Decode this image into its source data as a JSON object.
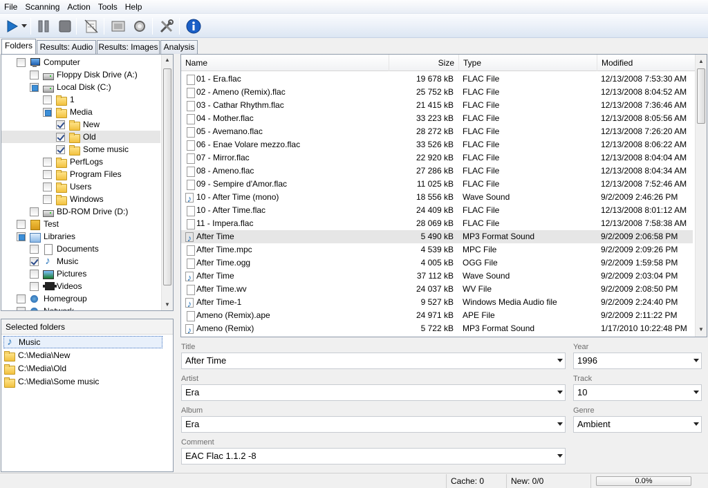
{
  "menu": [
    "File",
    "Scanning",
    "Action",
    "Tools",
    "Help"
  ],
  "toolbar": {
    "buttons": [
      "play-icon",
      "dropdown-arrow-icon",
      "pause-icon",
      "stop-icon",
      "clean-icon",
      "image-view-icon",
      "gear-scan-icon",
      "tools-icon",
      "info-icon"
    ]
  },
  "tabs": [
    "Folders",
    "Results: Audio",
    "Results: Images",
    "Analysis"
  ],
  "tree": [
    {
      "label": "Computer",
      "state": "none",
      "icon": "computer"
    },
    {
      "label": "Floppy Disk Drive (A:)",
      "state": "none",
      "icon": "drive"
    },
    {
      "label": "Local Disk (C:)",
      "state": "partial",
      "icon": "drive"
    },
    {
      "label": "1",
      "state": "none",
      "icon": "folder"
    },
    {
      "label": "Media",
      "state": "partial",
      "icon": "folder"
    },
    {
      "label": "New",
      "state": "checked",
      "icon": "folder"
    },
    {
      "label": "Old",
      "state": "checked",
      "icon": "folder"
    },
    {
      "label": "Some music",
      "state": "checked",
      "icon": "folder"
    },
    {
      "label": "PerfLogs",
      "state": "none",
      "icon": "folder"
    },
    {
      "label": "Program Files",
      "state": "none",
      "icon": "folder"
    },
    {
      "label": "Users",
      "state": "none",
      "icon": "folder"
    },
    {
      "label": "Windows",
      "state": "none",
      "icon": "folder"
    },
    {
      "label": "BD-ROM Drive (D:)",
      "state": "none",
      "icon": "drive"
    },
    {
      "label": "Test",
      "state": "none",
      "icon": "user"
    },
    {
      "label": "Libraries",
      "state": "partial",
      "icon": "library"
    },
    {
      "label": "Documents",
      "state": "none",
      "icon": "doc"
    },
    {
      "label": "Music",
      "state": "checked",
      "icon": "music"
    },
    {
      "label": "Pictures",
      "state": "none",
      "icon": "pictures"
    },
    {
      "label": "Videos",
      "state": "none",
      "icon": "videos"
    },
    {
      "label": "Homegroup",
      "state": "none",
      "icon": "homegroup"
    },
    {
      "label": "Network",
      "state": "none",
      "icon": "homegroup"
    }
  ],
  "selected_folders": {
    "header": "Selected folders",
    "items": [
      "Music",
      "C:\\Media\\New",
      "C:\\Media\\Old",
      "C:\\Media\\Some music"
    ]
  },
  "file_list": {
    "columns": [
      "Name",
      "Size",
      "Type",
      "Modified"
    ],
    "rows": [
      {
        "name": "01 - Era.flac",
        "size": "19 678 kB",
        "type": "FLAC File",
        "modified": "12/13/2008 7:53:30 AM",
        "icon": "doc"
      },
      {
        "name": "02 - Ameno (Remix).flac",
        "size": "25 752 kB",
        "type": "FLAC File",
        "modified": "12/13/2008 8:04:52 AM",
        "icon": "doc"
      },
      {
        "name": "03 - Cathar Rhythm.flac",
        "size": "21 415 kB",
        "type": "FLAC File",
        "modified": "12/13/2008 7:36:46 AM",
        "icon": "doc"
      },
      {
        "name": "04 - Mother.flac",
        "size": "33 223 kB",
        "type": "FLAC File",
        "modified": "12/13/2008 8:05:56 AM",
        "icon": "doc"
      },
      {
        "name": "05 - Avemano.flac",
        "size": "28 272 kB",
        "type": "FLAC File",
        "modified": "12/13/2008 7:26:20 AM",
        "icon": "doc"
      },
      {
        "name": "06 - Enae Volare mezzo.flac",
        "size": "33 526 kB",
        "type": "FLAC File",
        "modified": "12/13/2008 8:06:22 AM",
        "icon": "doc"
      },
      {
        "name": "07 - Mirror.flac",
        "size": "22 920 kB",
        "type": "FLAC File",
        "modified": "12/13/2008 8:04:04 AM",
        "icon": "doc"
      },
      {
        "name": "08 - Ameno.flac",
        "size": "27 286 kB",
        "type": "FLAC File",
        "modified": "12/13/2008 8:04:34 AM",
        "icon": "doc"
      },
      {
        "name": "09 - Sempire d'Amor.flac",
        "size": "11 025 kB",
        "type": "FLAC File",
        "modified": "12/13/2008 7:52:46 AM",
        "icon": "doc"
      },
      {
        "name": "10 - After Time (mono)",
        "size": "18 556 kB",
        "type": "Wave Sound",
        "modified": "9/2/2009 2:46:26 PM",
        "icon": "audio"
      },
      {
        "name": "10 - After Time.flac",
        "size": "24 409 kB",
        "type": "FLAC File",
        "modified": "12/13/2008 8:01:12 AM",
        "icon": "doc"
      },
      {
        "name": "11 - Impera.flac",
        "size": "28 069 kB",
        "type": "FLAC File",
        "modified": "12/13/2008 7:58:38 AM",
        "icon": "doc"
      },
      {
        "name": "After Time",
        "size": "5 490 kB",
        "type": "MP3 Format Sound",
        "modified": "9/2/2009 2:06:58 PM",
        "icon": "audio",
        "selected": true
      },
      {
        "name": "After Time.mpc",
        "size": "4 539 kB",
        "type": "MPC File",
        "modified": "9/2/2009 2:09:26 PM",
        "icon": "doc"
      },
      {
        "name": "After Time.ogg",
        "size": "4 005 kB",
        "type": "OGG File",
        "modified": "9/2/2009 1:59:58 PM",
        "icon": "doc"
      },
      {
        "name": "After Time",
        "size": "37 112 kB",
        "type": "Wave Sound",
        "modified": "9/2/2009 2:03:04 PM",
        "icon": "audio"
      },
      {
        "name": "After Time.wv",
        "size": "24 037 kB",
        "type": "WV File",
        "modified": "9/2/2009 2:08:50 PM",
        "icon": "doc"
      },
      {
        "name": "After Time-1",
        "size": "9 527 kB",
        "type": "Windows Media Audio file",
        "modified": "9/2/2009 2:24:40 PM",
        "icon": "audio"
      },
      {
        "name": "Ameno (Remix).ape",
        "size": "24 971 kB",
        "type": "APE File",
        "modified": "9/2/2009 2:11:22 PM",
        "icon": "doc"
      },
      {
        "name": "Ameno (Remix)",
        "size": "5 722 kB",
        "type": "MP3 Format Sound",
        "modified": "1/17/2010 10:22:48 PM",
        "icon": "audio"
      }
    ]
  },
  "tags": {
    "title_label": "Title",
    "title_value": "After Time",
    "artist_label": "Artist",
    "artist_value": "Era",
    "album_label": "Album",
    "album_value": "Era",
    "comment_label": "Comment",
    "comment_value": "EAC Flac 1.1.2 -8",
    "year_label": "Year",
    "year_value": "1996",
    "track_label": "Track",
    "track_value": "10",
    "genre_label": "Genre",
    "genre_value": "Ambient"
  },
  "status": {
    "cache": "Cache: 0",
    "new": "New: 0/0",
    "progress": "0.0%",
    "progress_fraction": 0.0
  }
}
